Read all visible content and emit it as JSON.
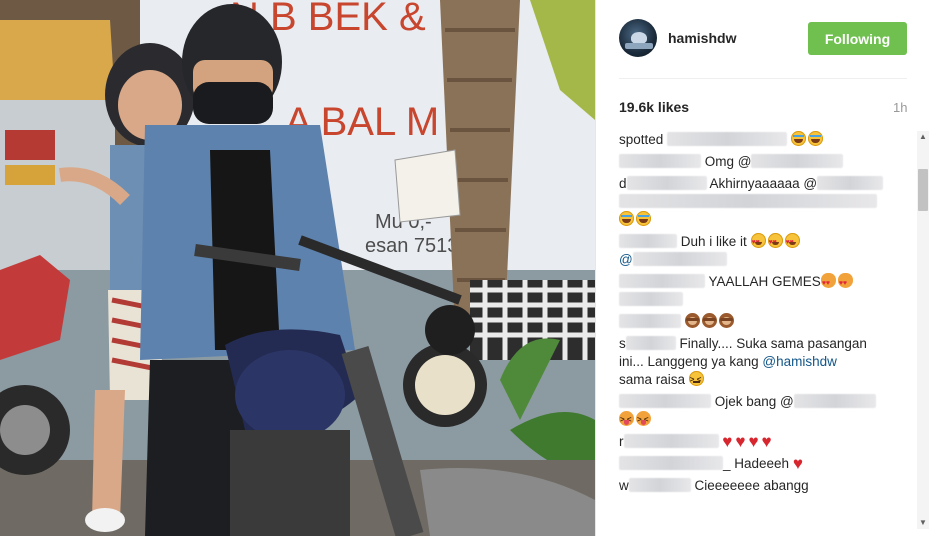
{
  "photo": {
    "bg_color": "#7a8a93",
    "banner_text_1": "N  B BEK &",
    "banner_text_2": "A BAL M AH",
    "sign_text": "Mu      0,-",
    "sign_text_2": "esan       751348"
  },
  "header": {
    "username": "hamishdw",
    "follow_label": "Following",
    "follow_color": "#70c050"
  },
  "likes": "19.6k likes",
  "time": "1h",
  "comments": [
    {
      "pre": "spotted",
      "text": "",
      "emoji": [
        "grinning-squint",
        "grinning-squint"
      ]
    },
    {
      "pre": "",
      "text": "Omg @",
      "emoji": []
    },
    {
      "pre": "d",
      "text": "Akhirnyaaaaaa @",
      "emoji": [
        "grinning-squint",
        "grinning-squint"
      ]
    },
    {
      "pre": "",
      "text": "Duh i like it",
      "emoji": [
        "heart-eyes",
        "heart-eyes",
        "heart-eyes"
      ],
      "extra": "@"
    },
    {
      "pre": "",
      "text": "YAALLAH GEMES",
      "emoji": [
        "heart-eyes-cat",
        "heart-eyes-cat"
      ]
    },
    {
      "pre": "",
      "text": "",
      "emoji": [
        "see-no-evil-monkey",
        "see-no-evil-monkey",
        "see-no-evil-monkey"
      ]
    },
    {
      "pre": "s",
      "text": "Finally.... Suka sama pasangan ini... Langgeng ya kang",
      "mention": "@hamishdw",
      "text2": "sama raisa",
      "emoji": [
        "confounded"
      ]
    },
    {
      "pre": "",
      "text": "Ojek bang @",
      "emoji": [
        "squinting-tongue",
        "squinting-tongue"
      ]
    },
    {
      "pre": "r",
      "text": "",
      "emoji": [
        "heart",
        "heart",
        "heart",
        "heart"
      ]
    },
    {
      "pre": "",
      "text": "_ Hadeeeh",
      "emoji": [
        "heart"
      ]
    },
    {
      "pre": "w",
      "text": "Cieeeeeee abangg",
      "emoji": []
    }
  ],
  "scrollbar": {
    "up_icon": "triangle-up",
    "down_icon": "triangle-down"
  }
}
